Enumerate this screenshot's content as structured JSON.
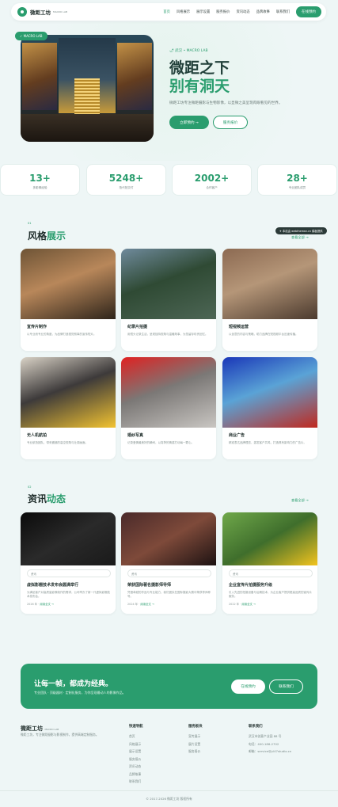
{
  "nav": {
    "brand": "微距工坊",
    "brand_sub": "MACRO LAB",
    "links": [
      "首页",
      "风格展示",
      "展示设置",
      "服务报价",
      "资讯动态",
      "品牌故事",
      "联系我们"
    ],
    "cta": "在线预约"
  },
  "hero": {
    "badge": "✓ MACRO LAB",
    "tag": "🌶 武汉 • MACRO LAB",
    "title1": "微距之下",
    "title2": "别有洞天",
    "desc": "微距工坊专注微距摄影与生物影像，以显微之美呈现肉眼看见的世界。",
    "btn_primary": "立即预约 →",
    "btn_secondary": "服务报价"
  },
  "stats": [
    {
      "num": "13+",
      "label": "多影像经验"
    },
    {
      "num": "5248+",
      "label": "拍代拍交付"
    },
    {
      "num": "2002+",
      "label": "合作客户"
    },
    {
      "num": "28+",
      "label": "专业团队成员"
    }
  ],
  "styles": {
    "no": "01",
    "title_a": "风格",
    "title_b": "展示",
    "more": "查看全部 →",
    "toast": "✈ 本站由 webthemez.cn 模板提供",
    "cards": [
      {
        "title": "宣传片制作",
        "desc": "以专业而专业的角度，为品牌打造视觉叙事的宣传短片。",
        "colors": [
          "#6e5436",
          "#2e241a",
          "#b8875a"
        ]
      },
      {
        "title": "纪录片拍摄",
        "desc": "用镜头记录生活，呈现独特视角与温暖故事，为您留存珍贵回忆。",
        "colors": [
          "#6f8a9c",
          "#4d6655",
          "#2f4a34"
        ]
      },
      {
        "title": "短视频运营",
        "desc": "以创意的内容与策略，助力品牌在短视频平台迅速传播。",
        "colors": [
          "#8c6a52",
          "#4b3a2e",
          "#b59678"
        ]
      },
      {
        "title": "无人机航拍",
        "desc": "专业航拍团队，带来震撼的高空视角与壮观画面。",
        "colors": [
          "#d9d2c6",
          "#f2c331",
          "#3d3a3a"
        ]
      },
      {
        "title": "婚纱写真",
        "desc": "记录爱情最美好的瞬间，以真挚的情感打动每一颗心。",
        "colors": [
          "#e02121",
          "#c9c6c2",
          "#7b7876"
        ]
      },
      {
        "title": "商业广告",
        "desc": "精准表达品牌理念，激发客户共鸣，打造具有影响力的广告片。",
        "colors": [
          "#1a37b8",
          "#c0291f",
          "#5aa3d6"
        ]
      }
    ]
  },
  "news": {
    "no": "02",
    "title_a": "资讯",
    "title_b": "动态",
    "more": "查看全部 →",
    "items": [
      {
        "tag": "资讯",
        "title": "虚拟影棚技术发布会圆满举行",
        "desc": "为满足客户对高质量影像制作的需求，公司举办了新一代虚拟影棚技术发布会。",
        "date": "2026 年",
        "more": "阅读全文 →",
        "colors": [
          "#0b0b0b",
          "#1a1a1a",
          "#2a2a2a"
        ]
      },
      {
        "tag": "资讯",
        "title": "荣获国际著名摄影师导师",
        "desc": "凭借卓越的作品与专业能力，我们团队在国际摄影大赛中荣获导师称号。",
        "date": "2024 年",
        "more": "阅读全文 →",
        "colors": [
          "#4a2a2a",
          "#1d1212",
          "#7e4a3a"
        ]
      },
      {
        "tag": "资讯",
        "title": "企业宣传片拍摄服务升级",
        "desc": "引入先进的拍摄设备与后期技术，为企业客户提供更高品质的宣传片服务。",
        "date": "2022 年",
        "more": "阅读全文 →",
        "colors": [
          "#6fa84a",
          "#f2c31e",
          "#3f6e2c"
        ]
      }
    ]
  },
  "cta": {
    "title": "让每一帧，都成为经典。",
    "sub": "专业团队 · 顶级器材 · 定制化服务，为你呈现最动人的影像作品。",
    "btn1": "在线预约",
    "btn2": "联系我们"
  },
  "footer": {
    "brand": "微距工坊",
    "brand_sub": "MACRO LAB",
    "desc": "微距工坊，专注微距摄影与影视制作，提供高端定制服务。",
    "col1": {
      "title": "快速导航",
      "items": [
        "首页",
        "风格展示",
        "展示设置",
        "服务报价",
        "资讯动态",
        "品牌故事",
        "联系我们"
      ]
    },
    "col2": {
      "title": "服务板块",
      "items": [
        "宣传展示",
        "展片设置",
        "服务报价"
      ]
    },
    "col3": {
      "title": "联系我们",
      "items": [
        "武汉市创意产业园 88 号",
        "电话：400-186-2702",
        "邮箱：service@yl47studio.cn"
      ]
    },
    "copyright": "© 2017-2026 微距工坊 版权所有"
  }
}
